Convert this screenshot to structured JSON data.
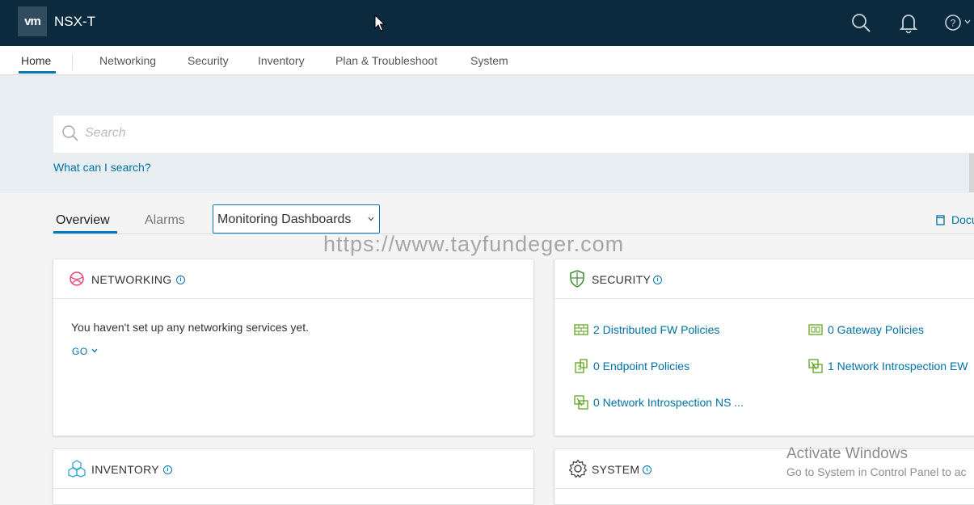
{
  "header": {
    "logo": "vm",
    "app_title": "NSX-T"
  },
  "nav": {
    "items": [
      "Home",
      "Networking",
      "Security",
      "Inventory",
      "Plan & Troubleshoot",
      "System"
    ]
  },
  "search": {
    "placeholder": "Search",
    "help_link": "What can I search?"
  },
  "tabs": {
    "overview": "Overview",
    "alarms": "Alarms",
    "dropdown_label": "Monitoring Dashboards",
    "docs": "Docu"
  },
  "watermark": "https://www.tayfundeger.com",
  "cards": {
    "networking": {
      "title": "NETWORKING",
      "message": "You haven't set up any networking services yet.",
      "go": "GO"
    },
    "security": {
      "title": "SECURITY",
      "policies": [
        "2 Distributed FW Policies",
        "0 Gateway Policies",
        "0 Endpoint Policies",
        "1 Network Introspection EW",
        "0 Network Introspection NS ..."
      ]
    },
    "inventory": {
      "title": "INVENTORY"
    },
    "system": {
      "title": "SYSTEM"
    }
  },
  "os_overlay": {
    "line1": "Activate Windows",
    "line2": "Go to System in Control Panel to ac"
  },
  "colors": {
    "header_bg": "#0c2a3e",
    "accent": "#0079b8",
    "link": "#0072a3",
    "networking_icon": "#e8407b",
    "security_icon": "#3c8a2e",
    "inventory_icon": "#35a8d6"
  }
}
